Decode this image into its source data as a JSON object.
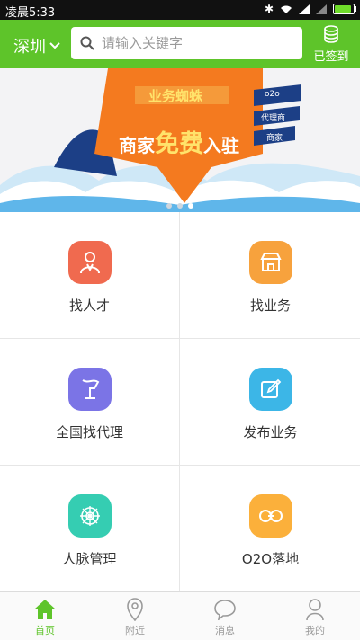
{
  "statusbar": {
    "time": "凌晨5:33",
    "battery_level": 0.9
  },
  "header": {
    "city": "深圳",
    "search_placeholder": "请输入关键字",
    "signin_label": "已签到"
  },
  "banner": {
    "tagline": "业务蜘蛛",
    "headline_pre": "商家",
    "headline_emph": "免费",
    "headline_post": "入驻",
    "tags": [
      "o2o",
      "代理商",
      "商家"
    ],
    "slides": 3,
    "active_slide": 3
  },
  "grid": [
    {
      "label": "找人才",
      "icon": "talent-icon",
      "color": "#f06a4f"
    },
    {
      "label": "找业务",
      "icon": "shop-icon",
      "color": "#f7a23d"
    },
    {
      "label": "全国找代理",
      "icon": "agent-flag-icon",
      "color": "#7b74e6"
    },
    {
      "label": "发布业务",
      "icon": "edit-icon",
      "color": "#3cb6e7"
    },
    {
      "label": "人脉管理",
      "icon": "network-icon",
      "color": "#35cdb2"
    },
    {
      "label": "O2O落地",
      "icon": "o2o-icon",
      "color": "#fbb03b"
    }
  ],
  "tabbar": [
    {
      "label": "首页",
      "icon": "home-icon",
      "active": true
    },
    {
      "label": "附近",
      "icon": "location-pin-icon",
      "active": false
    },
    {
      "label": "消息",
      "icon": "message-bubble-icon",
      "active": false
    },
    {
      "label": "我的",
      "icon": "profile-icon",
      "active": false
    }
  ],
  "colors": {
    "brand_green": "#5ec42a",
    "banner_orange": "#f47a1f",
    "banner_navy": "#1c3f86",
    "sky_blue": "#5fb6ea"
  }
}
